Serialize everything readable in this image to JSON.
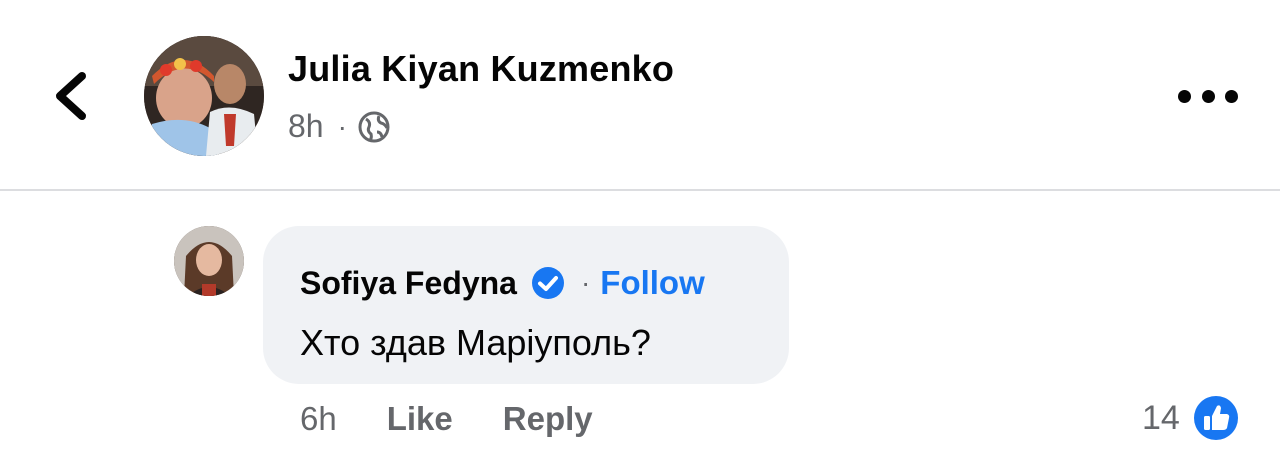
{
  "post": {
    "author": "Julia Kiyan Kuzmenko",
    "time": "8h",
    "separator": "·",
    "privacy_icon": "globe-icon",
    "more_icon": "ellipsis-icon",
    "back_icon": "chevron-left-icon"
  },
  "comment": {
    "author": "Sofiya Fedyna",
    "verified_icon": "verified-badge-icon",
    "separator": "·",
    "follow_label": "Follow",
    "text": "Хто здав Маріуполь?",
    "time": "6h",
    "like_label": "Like",
    "reply_label": "Reply",
    "reaction_count": "14",
    "reaction_icon": "thumbs-up-icon"
  },
  "colors": {
    "accent": "#1877f2",
    "secondary_text": "#65676b",
    "bubble_bg": "#f0f2f5"
  }
}
